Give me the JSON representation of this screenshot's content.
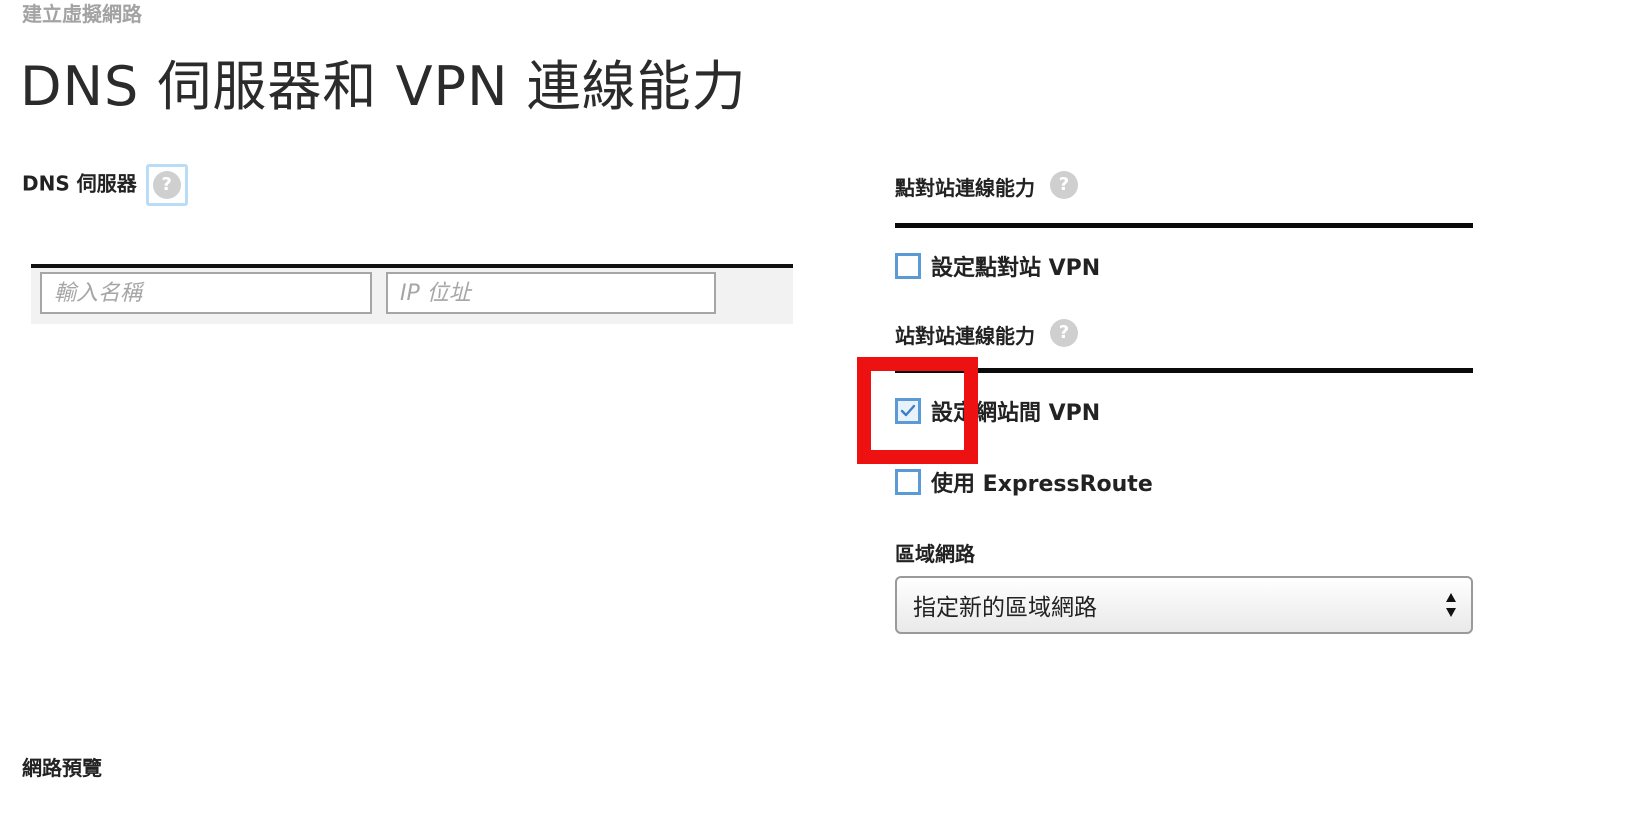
{
  "wizard": {
    "label": "建立虛擬網路"
  },
  "page": {
    "title": "DNS 伺服器和 VPN 連線能力"
  },
  "dns": {
    "label": "DNS 伺服器",
    "help_icon": "?",
    "name_placeholder": "輸入名稱",
    "ip_placeholder": "IP 位址"
  },
  "point_to_site": {
    "label": "點對站連線能力",
    "help_icon": "?",
    "configure_label": "設定點對站 VPN",
    "configure_checked": false
  },
  "site_to_site": {
    "label": "站對站連線能力",
    "help_icon": "?",
    "configure_label": "設定網站間 VPN",
    "configure_checked": true,
    "expressroute_label": "使用 ExpressRoute",
    "expressroute_checked": false
  },
  "local_network": {
    "label": "區域網路",
    "selected": "指定新的區域網路"
  },
  "network_preview": {
    "label": "網路預覽"
  },
  "colors": {
    "accent": "#5b9bd5",
    "highlight": "#ee1111",
    "title": "#2b2b2b",
    "muted": "#a3a3a3"
  }
}
